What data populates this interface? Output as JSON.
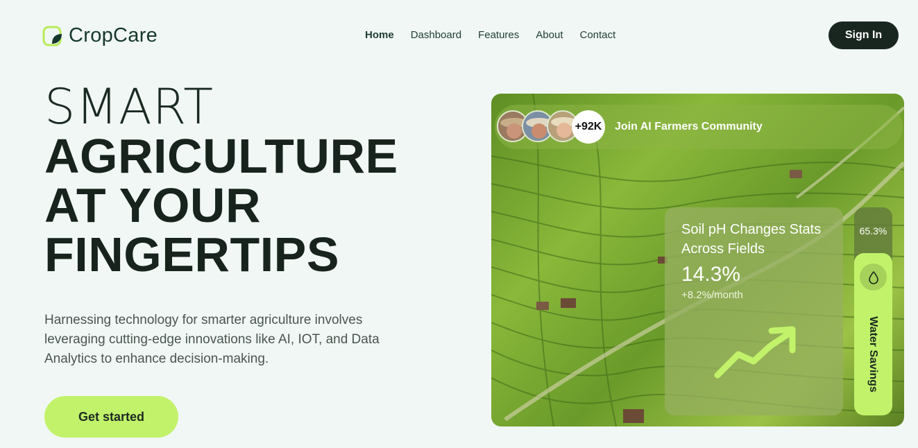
{
  "brand": {
    "name": "CropCare",
    "accent": "#c2f26a"
  },
  "nav": {
    "items": [
      "Home",
      "Dashboard",
      "Features",
      "About",
      "Contact"
    ],
    "active": "Home"
  },
  "header": {
    "signin_label": "Sign In"
  },
  "hero": {
    "line1": "SMART",
    "line2": "AGRICULTURE",
    "line3": "AT YOUR",
    "line4": "FINGERTIPS",
    "description": "Harnessing technology for smarter agriculture involves leveraging cutting-edge innovations like AI, IOT, and Data Analytics to enhance decision-making.",
    "cta_label": "Get started"
  },
  "community": {
    "count": "+92K",
    "label": "Join AI Farmers Community"
  },
  "stats": {
    "title": "Soil pH Changes Stats Across Fields",
    "value": "14.3%",
    "change": "+8.2%/month",
    "trend_icon": "trend-up-icon"
  },
  "water": {
    "percent": "65.3%",
    "label": "Water Savings",
    "icon": "water-drop-icon"
  }
}
